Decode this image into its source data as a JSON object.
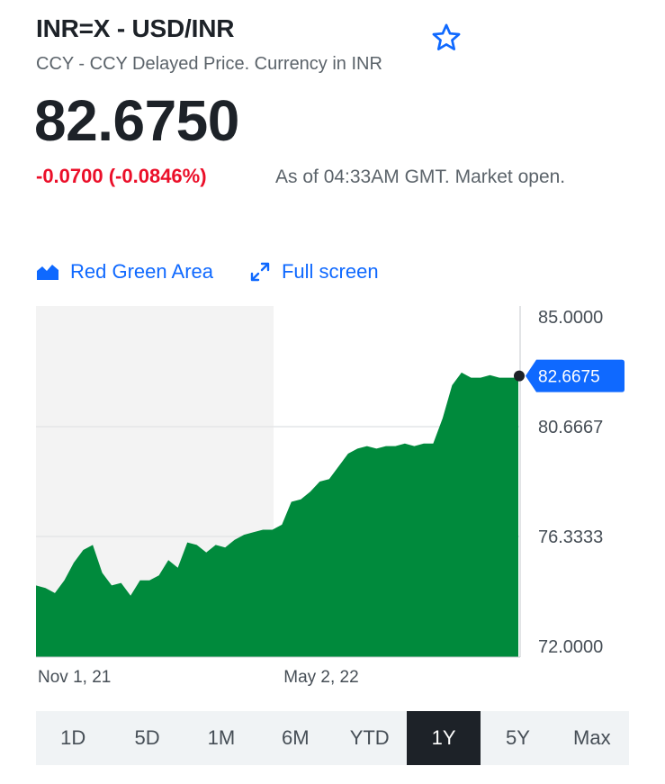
{
  "header": {
    "title": "INR=X - USD/INR",
    "subtitle": "CCY - CCY Delayed Price. Currency in INR"
  },
  "quote": {
    "price": "82.6750",
    "change": "-0.0700 (-0.0846%)",
    "as_of": "As of 04:33AM GMT. Market open."
  },
  "toolbar": {
    "chart_type_label": "Red Green Area",
    "fullscreen_label": "Full screen"
  },
  "colors": {
    "accent": "#0f69ff",
    "negative": "#eb0f29",
    "area_fill": "#008a3c"
  },
  "chart_data": {
    "type": "area",
    "title": "",
    "xlabel": "",
    "ylabel": "",
    "ylim": [
      72.0,
      85.0
    ],
    "y_ticks": [
      "85.0000",
      "80.6667",
      "76.3333",
      "72.0000"
    ],
    "x_tick_labels": [
      {
        "label": "Nov 1, 21",
        "index": 0
      },
      {
        "label": "May 2, 22",
        "index": 26
      }
    ],
    "current_value_label": "82.6675",
    "grid": true,
    "series": [
      {
        "values": [
          74.4,
          74.3,
          74.1,
          74.6,
          75.3,
          75.8,
          76.0,
          74.9,
          74.4,
          74.5,
          74.0,
          74.6,
          74.6,
          74.8,
          75.4,
          75.1,
          76.1,
          76.0,
          75.7,
          76.0,
          75.9,
          76.2,
          76.4,
          76.5,
          76.6,
          76.6,
          76.8,
          77.7,
          77.8,
          78.1,
          78.5,
          78.6,
          79.1,
          79.6,
          79.8,
          79.9,
          79.8,
          79.9,
          79.9,
          80.0,
          79.9,
          80.0,
          80.0,
          81.0,
          82.3,
          82.8,
          82.6,
          82.6,
          82.7,
          82.6,
          82.6,
          82.6
        ]
      }
    ]
  },
  "ranges": {
    "items": [
      "1D",
      "5D",
      "1M",
      "6M",
      "YTD",
      "1Y",
      "5Y",
      "Max"
    ],
    "active": "1Y"
  }
}
